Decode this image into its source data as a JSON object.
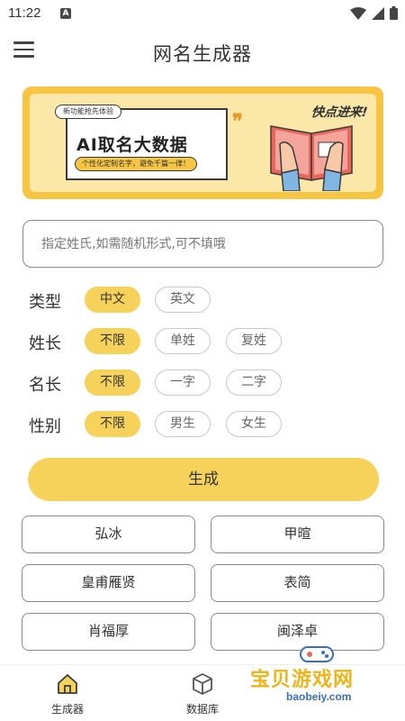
{
  "status": {
    "time": "11:22",
    "notif_letter": "A"
  },
  "app": {
    "title": "网名生成器"
  },
  "banner": {
    "pill": "新功能抢先体验",
    "title": "AI取名大数据",
    "subtitle": "个性化定制名字，避免千篇一律！",
    "corner": "快点进来!"
  },
  "search": {
    "placeholder": "指定姓氏,如需随机形式,可不填哦",
    "value": ""
  },
  "options": [
    {
      "label": "类型",
      "choices": [
        "中文",
        "英文"
      ],
      "selected": 0
    },
    {
      "label": "姓长",
      "choices": [
        "不限",
        "单姓",
        "复姓"
      ],
      "selected": 0
    },
    {
      "label": "名长",
      "choices": [
        "不限",
        "一字",
        "二字"
      ],
      "selected": 0
    },
    {
      "label": "性别",
      "choices": [
        "不限",
        "男生",
        "女生"
      ],
      "selected": 0
    }
  ],
  "generate_label": "生成",
  "results": [
    "弘冰",
    "甲暄",
    "皇甫雁贤",
    "表简",
    "肖福厚",
    "闽泽卓"
  ],
  "nav": [
    {
      "label": "生成器",
      "icon": "home-icon"
    },
    {
      "label": "数据库",
      "icon": "cube-icon"
    }
  ],
  "watermark": {
    "text": "宝贝游戏网",
    "url": "baobeiy.com"
  },
  "colors": {
    "accent": "#f6d25a",
    "banner_bg": "#f6c544",
    "banner_inner": "#fbe7a8"
  }
}
